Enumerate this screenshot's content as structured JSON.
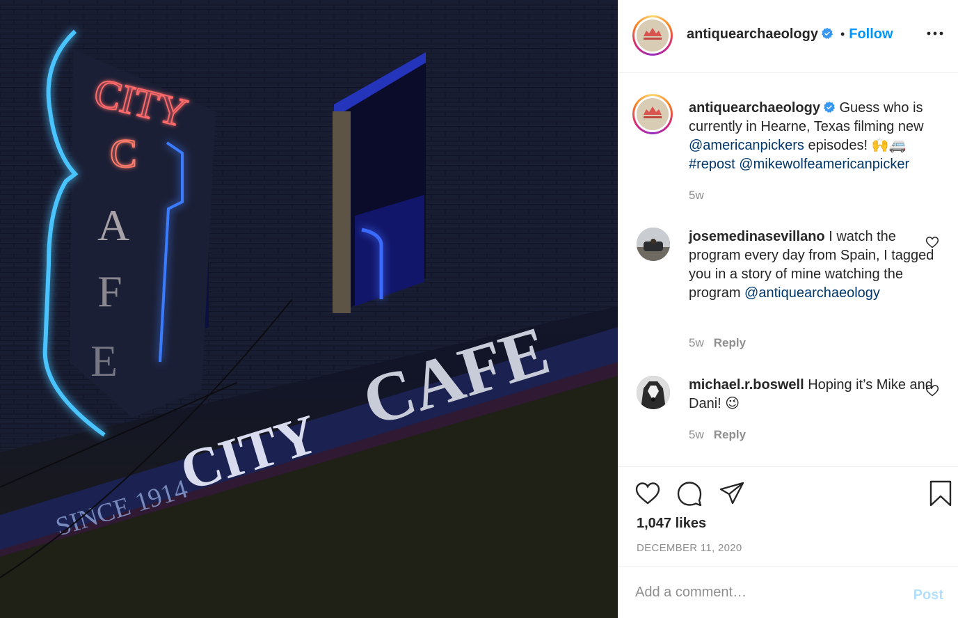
{
  "photo": {
    "sign_vertical_top": "CITY",
    "sign_vertical_letters": [
      "C",
      "A",
      "F",
      "E"
    ],
    "wall_since": "SINCE 1914",
    "wall_city": "CITY",
    "wall_cafe": "CAFE"
  },
  "header": {
    "username": "antiquearchaeology",
    "verified_icon": "verified-badge-icon",
    "separator": "•",
    "follow_label": "Follow",
    "more_icon": "more-options-icon"
  },
  "caption": {
    "username": "antiquearchaeology",
    "text_1": "Guess who is currently in Hearne, Texas filming new",
    "mention_1": "@americanpickers",
    "text_2": "episodes!",
    "emoji": "🙌🚐",
    "hashtag": "#repost",
    "mention_2": "@mikewolfeamericanpicker",
    "time": "5w"
  },
  "comments": [
    {
      "username": "josemedinasevillano",
      "text": "I watch the program every day from Spain, I tagged you in a story of mine watching the program",
      "mention": "@antiquearchaeology",
      "time": "5w",
      "reply_label": "Reply"
    },
    {
      "username": "michael.r.boswell",
      "text": "Hoping it’s Mike and Dani!",
      "emoji": "😉",
      "time": "5w",
      "reply_label": "Reply"
    }
  ],
  "actions": {
    "like_icon": "heart-icon",
    "comment_icon": "comment-bubble-icon",
    "share_icon": "paper-plane-icon",
    "save_icon": "bookmark-icon",
    "likes": "1,047 likes",
    "date": "DECEMBER 11, 2020"
  },
  "comment_box": {
    "placeholder": "Add a comment…",
    "post_label": "Post"
  },
  "colors": {
    "link_blue": "#0095f6",
    "mention_blue": "#00376b",
    "muted": "#8e8e8e",
    "post_disabled": "#b2dffc"
  }
}
